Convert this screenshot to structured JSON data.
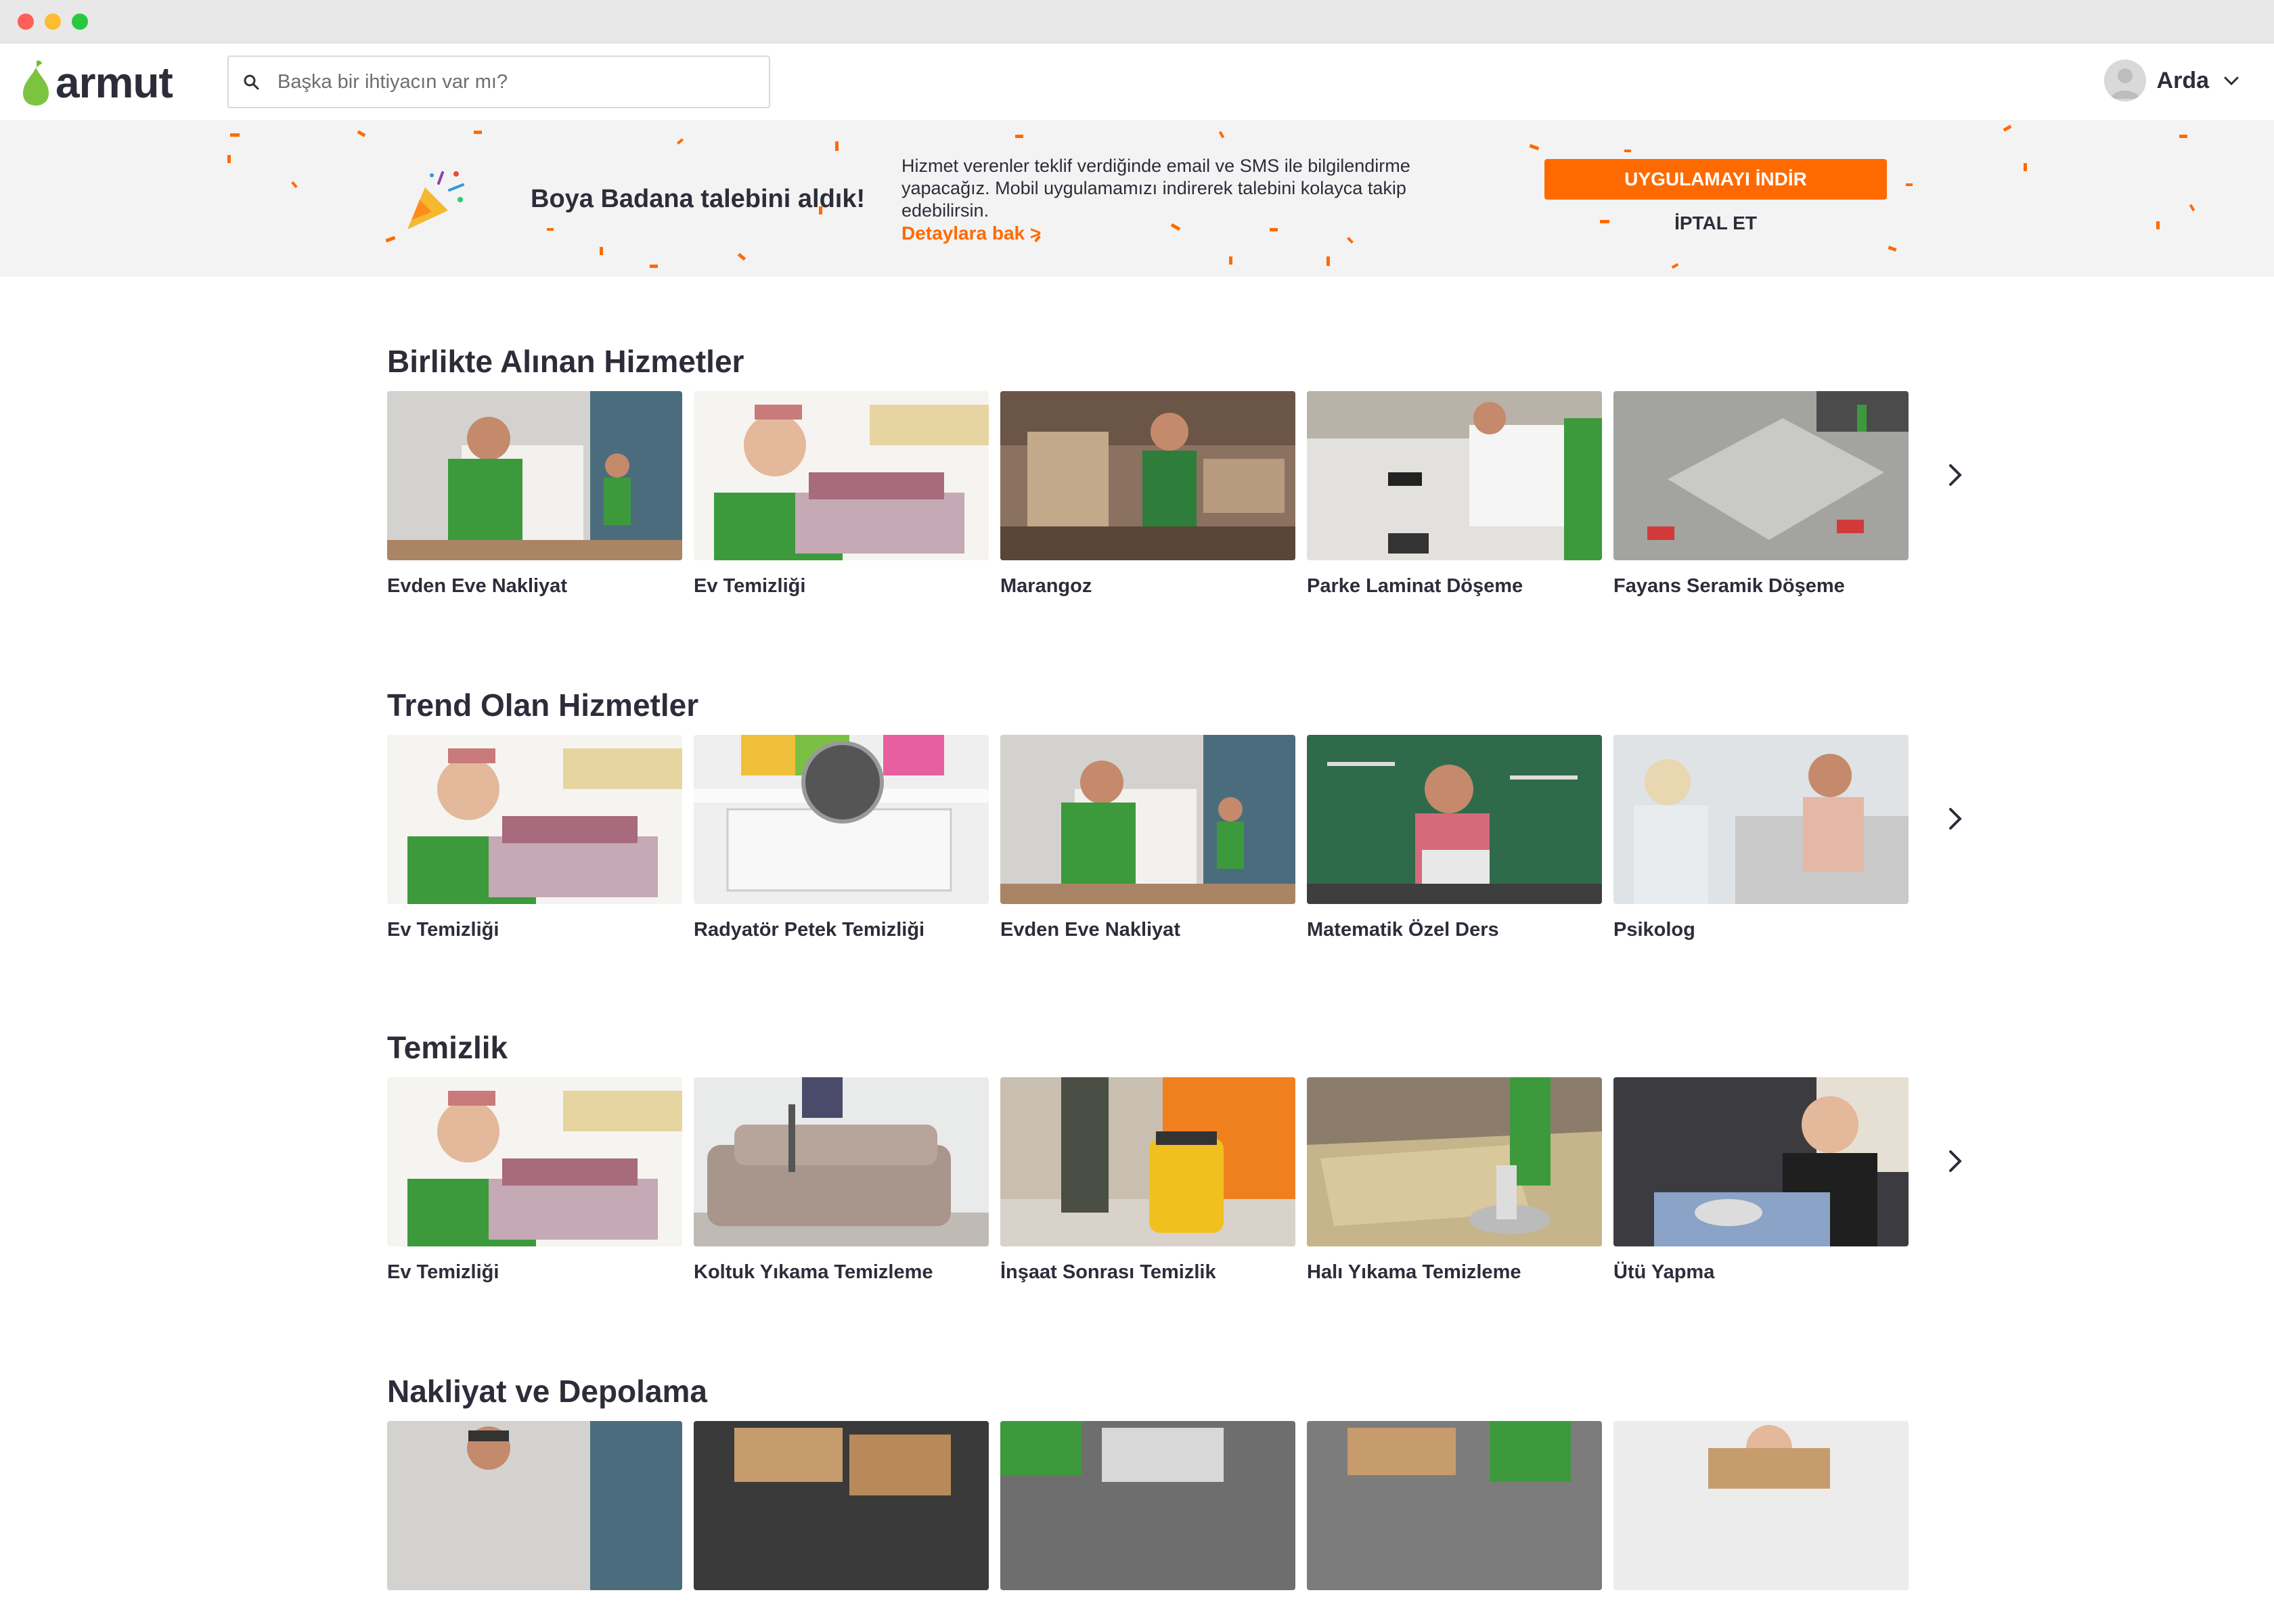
{
  "app": {
    "logo_text": "armut"
  },
  "search": {
    "placeholder": "Başka bir ihtiyacın var mı?"
  },
  "user": {
    "name": "Arda"
  },
  "banner": {
    "title": "Boya Badana talebini aldık!",
    "text": "Hizmet verenler teklif verdiğinde email ve SMS ile bilgilendirme yapacağız. Mobil uygulamamızı indirerek talebini kolayca takip edebilirsin.",
    "link": "Detaylara bak >",
    "download_button": "UYGULAMAYI İNDİR",
    "cancel_button": "İPTAL ET"
  },
  "colors": {
    "accent": "#ff6a00",
    "text": "#2d2d3a",
    "banner_bg": "#f3f3f3"
  },
  "sections": [
    {
      "title": "Birlikte Alınan Hizmetler",
      "items": [
        "Evden Eve Nakliyat",
        "Ev Temizliği",
        "Marangoz",
        "Parke Laminat Döşeme",
        "Fayans Seramik Döşeme"
      ]
    },
    {
      "title": "Trend Olan Hizmetler",
      "items": [
        "Ev Temizliği",
        "Radyatör Petek Temizliği",
        "Evden Eve Nakliyat",
        "Matematik Özel Ders",
        "Psikolog"
      ]
    },
    {
      "title": "Temizlik",
      "items": [
        "Ev Temizliği",
        "Koltuk Yıkama Temizleme",
        "İnşaat Sonrası Temizlik",
        "Halı Yıkama Temizleme",
        "Ütü Yapma"
      ]
    },
    {
      "title": "Nakliyat ve Depolama",
      "items": [
        "",
        "",
        "",
        "",
        ""
      ]
    }
  ]
}
